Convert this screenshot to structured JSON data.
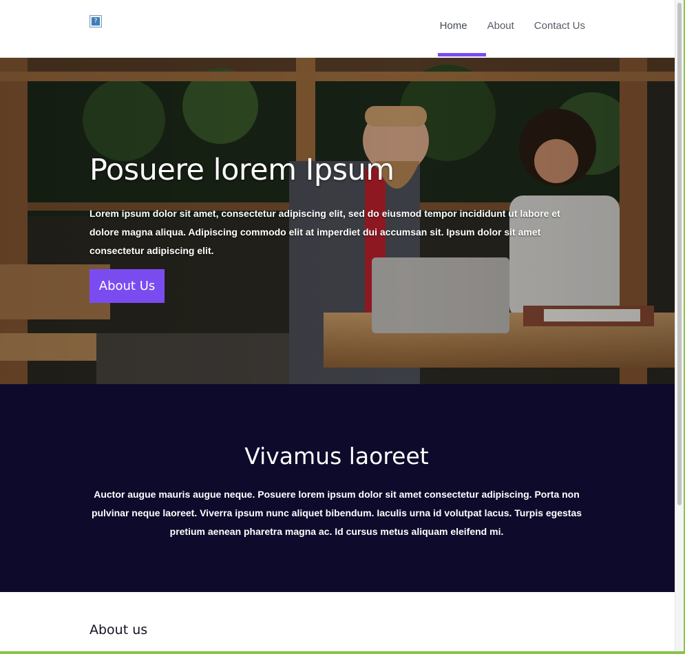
{
  "header": {
    "logo_alt": "?",
    "nav": [
      {
        "label": "Home",
        "active": true
      },
      {
        "label": "About",
        "active": false
      },
      {
        "label": "Contact Us",
        "active": false
      }
    ]
  },
  "hero": {
    "title": "Posuere lorem Ipsum",
    "text": "Lorem ipsum dolor sit amet, consectetur adipiscing elit, sed do eiusmod tempor incididunt ut labore et dolore magna aliqua. Adipiscing commodo elit at imperdiet dui accumsan sit. Ipsum dolor sit amet consectetur adipiscing elit.",
    "button_label": "About Us",
    "image": "office-meeting-photo"
  },
  "feature": {
    "title": "Vivamus laoreet",
    "text": "Auctor augue mauris augue neque. Posuere lorem ipsum dolor sit amet consectetur adipiscing. Porta non pulvinar neque laoreet. Viverra ipsum nunc aliquet bibendum. Iaculis urna id volutpat lacus. Turpis egestas pretium aenean pharetra magna ac. Id cursus metus aliquam eleifend mi."
  },
  "about": {
    "heading": "About us"
  },
  "colors": {
    "accent": "#7a4cf0",
    "dark_section": "#0e0a2b",
    "frame": "#8bc34a",
    "nav_text": "#555b66"
  }
}
